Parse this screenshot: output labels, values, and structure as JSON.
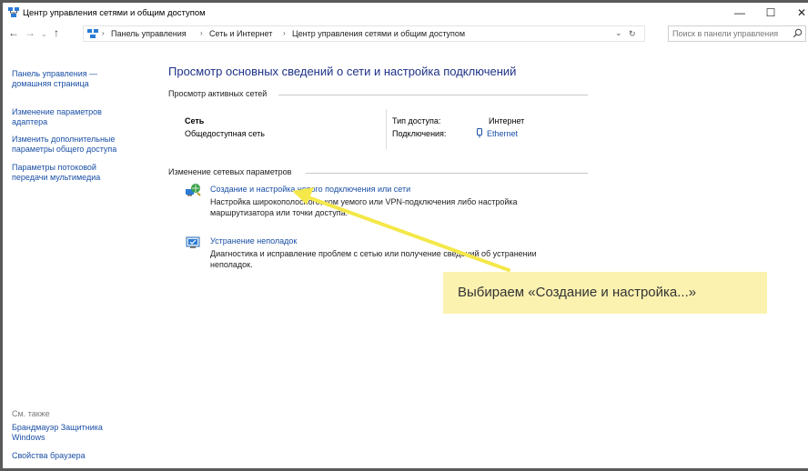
{
  "window": {
    "title": "Центр управления сетями и общим доступом",
    "controls": {
      "minimize": "—",
      "maximize": "☐",
      "close": "✕"
    }
  },
  "address": {
    "back_icon": "arrow-left-icon",
    "forward_icon": "arrow-right-icon",
    "recent_icon": "chevron-down-icon",
    "up_icon": "arrow-up-icon",
    "breadcrumb": [
      "Панель управления",
      "Сеть и Интернет",
      "Центр управления сетями и общим доступом"
    ],
    "search_placeholder": "Поиск в панели управления"
  },
  "sidebar": {
    "links": [
      {
        "line1": "Панель управления —",
        "line2": "домашняя страница"
      },
      {
        "line1": "Изменение параметров",
        "line2": "адаптера"
      },
      {
        "line1": "Изменить дополнительные",
        "line2": "параметры общего доступа"
      },
      {
        "line1": "Параметры потоковой",
        "line2": "передачи мультимедиа"
      }
    ],
    "see_also_label": "См. также",
    "see_also": [
      {
        "line1": "Брандмауэр Защитника",
        "line2": "Windows"
      },
      {
        "line1": "Свойства браузера",
        "line2": ""
      }
    ]
  },
  "main": {
    "title": "Просмотр основных сведений о сети и настройка подключений",
    "active_networks": {
      "heading": "Просмотр активных сетей",
      "network_name": "Сеть",
      "network_type": "Общедоступная сеть",
      "access_type_label": "Тип доступа:",
      "access_type_value": "Интернет",
      "connections_label": "Подключения:",
      "connections_value": "Ethernet"
    },
    "change_settings": {
      "heading": "Изменение сетевых параметров",
      "items": [
        {
          "icon": "network-setup-icon",
          "link": "Создание и настройка нового подключения или сети",
          "desc_line1": "Настройка широкополосного, ком    уемого или VPN-подключения либо настройка",
          "desc_line2": "маршрутизатора или точки доступа."
        },
        {
          "icon": "troubleshoot-icon",
          "link": "Устранение неполадок",
          "desc_line1": "Диагностика и исправление проблем с сетью или получение сведений об устранении",
          "desc_line2": "неполадок."
        }
      ]
    }
  },
  "callout": {
    "text": "Выбираем «Создание и настройка...»",
    "color": "#fcf2b0",
    "arrow_color": "#f4e84a"
  }
}
